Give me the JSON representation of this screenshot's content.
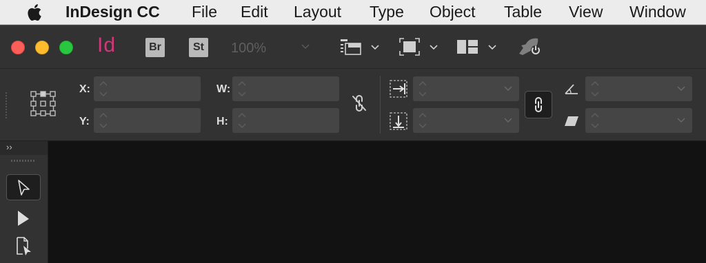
{
  "menubar": {
    "app_name": "InDesign CC",
    "items": [
      "File",
      "Edit",
      "Layout",
      "Type",
      "Object",
      "Table",
      "View",
      "Window"
    ]
  },
  "appbar": {
    "app_logo": "Id",
    "bridge_label": "Br",
    "stock_label": "St",
    "zoom_level": "100%",
    "icons": [
      "screen-mode-icon",
      "view-options-icon",
      "arrange-documents-icon",
      "publish-online-icon"
    ]
  },
  "control_panel": {
    "x_label": "X:",
    "y_label": "Y:",
    "w_label": "W:",
    "h_label": "H:",
    "x_value": "",
    "y_value": "",
    "w_value": "",
    "h_value": "",
    "scale_x_value": "",
    "scale_y_value": "",
    "rotation_value": "",
    "shear_value": ""
  },
  "tools_panel": {
    "collapse_label": "››",
    "tools": [
      "selection-tool",
      "direct-selection-tool",
      "page-tool"
    ]
  },
  "colors": {
    "menubar_bg": "#ececec",
    "panel_bg": "#323232",
    "field_bg": "#454545",
    "canvas_bg": "#121212",
    "indesign_accent": "#d1387a",
    "close": "#fc5f57",
    "minimize": "#fdbb2e",
    "zoom": "#29c73f"
  }
}
